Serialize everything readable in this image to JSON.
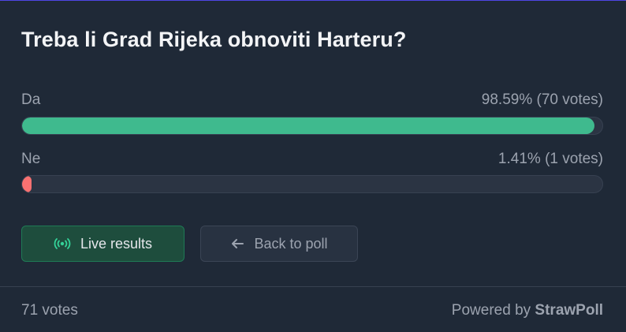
{
  "poll": {
    "title": "Treba li Grad Rijeka obnoviti Harteru?",
    "options": [
      {
        "label": "Da",
        "result": "98.59% (70 votes)",
        "fraction": 0.9859,
        "color": "#3fba8e"
      },
      {
        "label": "Ne",
        "result": "1.41% (1 votes)",
        "fraction": 0.0141,
        "color": "#f87171"
      }
    ]
  },
  "buttons": {
    "live_label": "Live results",
    "back_label": "Back to poll"
  },
  "footer": {
    "total_votes": "71 votes",
    "powered_prefix": "Powered by",
    "powered_brand": "StrawPoll"
  },
  "icons": {
    "live": "broadcast-icon",
    "back": "arrow-left-icon"
  },
  "colors": {
    "live_green": "#34d399"
  }
}
